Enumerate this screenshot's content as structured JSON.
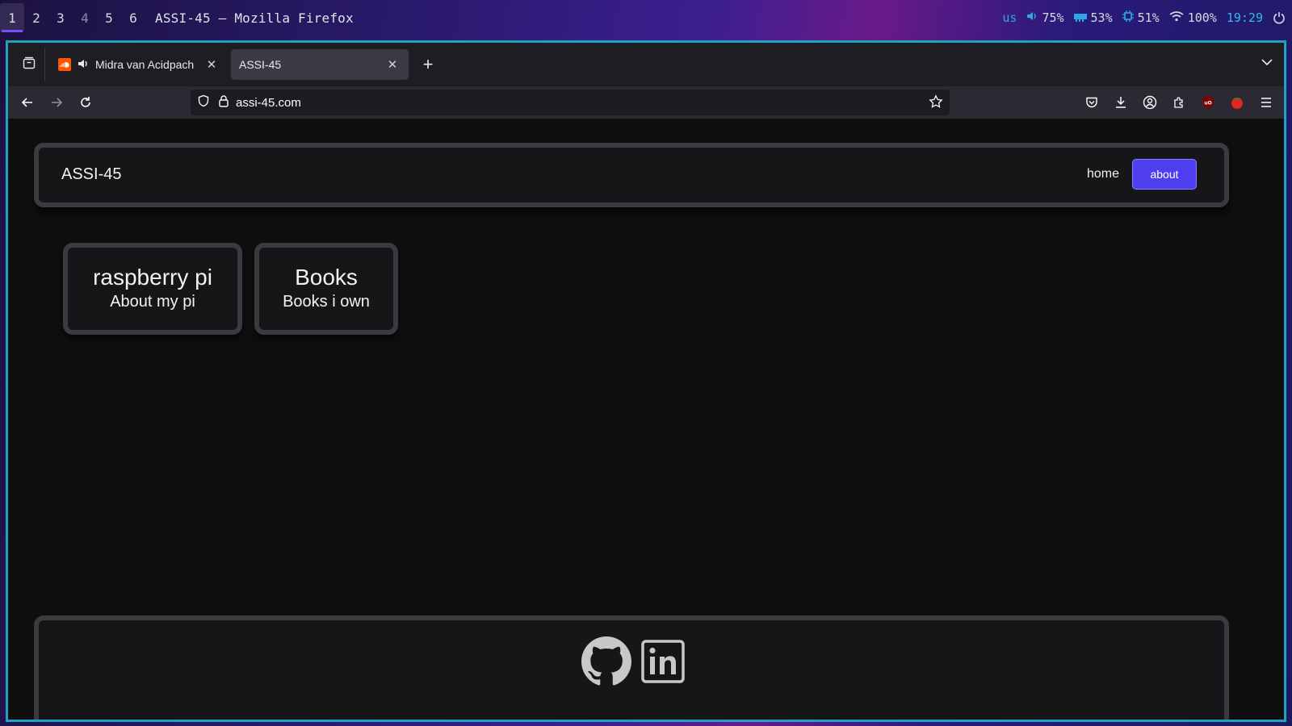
{
  "system_bar": {
    "workspaces": [
      "1",
      "2",
      "3",
      "4",
      "5",
      "6"
    ],
    "active_workspace": "1",
    "window_title": "ASSI-45 — Mozilla Firefox",
    "keyboard_layout": "us",
    "volume": "75%",
    "memory": "53%",
    "cpu": "51%",
    "wifi": "100%",
    "clock": "19:29"
  },
  "browser": {
    "tabs": [
      {
        "label": "Midra van Acidpach",
        "playing_audio": true
      },
      {
        "label": "ASSI-45",
        "active": true
      }
    ],
    "url": "assi-45.com"
  },
  "site": {
    "logo": "ASSI-45",
    "nav": {
      "home": "home",
      "about": "about"
    },
    "cards": [
      {
        "title": "raspberry pi",
        "subtitle": "About my pi"
      },
      {
        "title": "Books",
        "subtitle": "Books i own"
      }
    ]
  },
  "colors": {
    "accent": "#4f3df0",
    "window_border": "#1fa1c0",
    "page_bg": "#0f0f10",
    "card_border": "#3a3a40"
  }
}
